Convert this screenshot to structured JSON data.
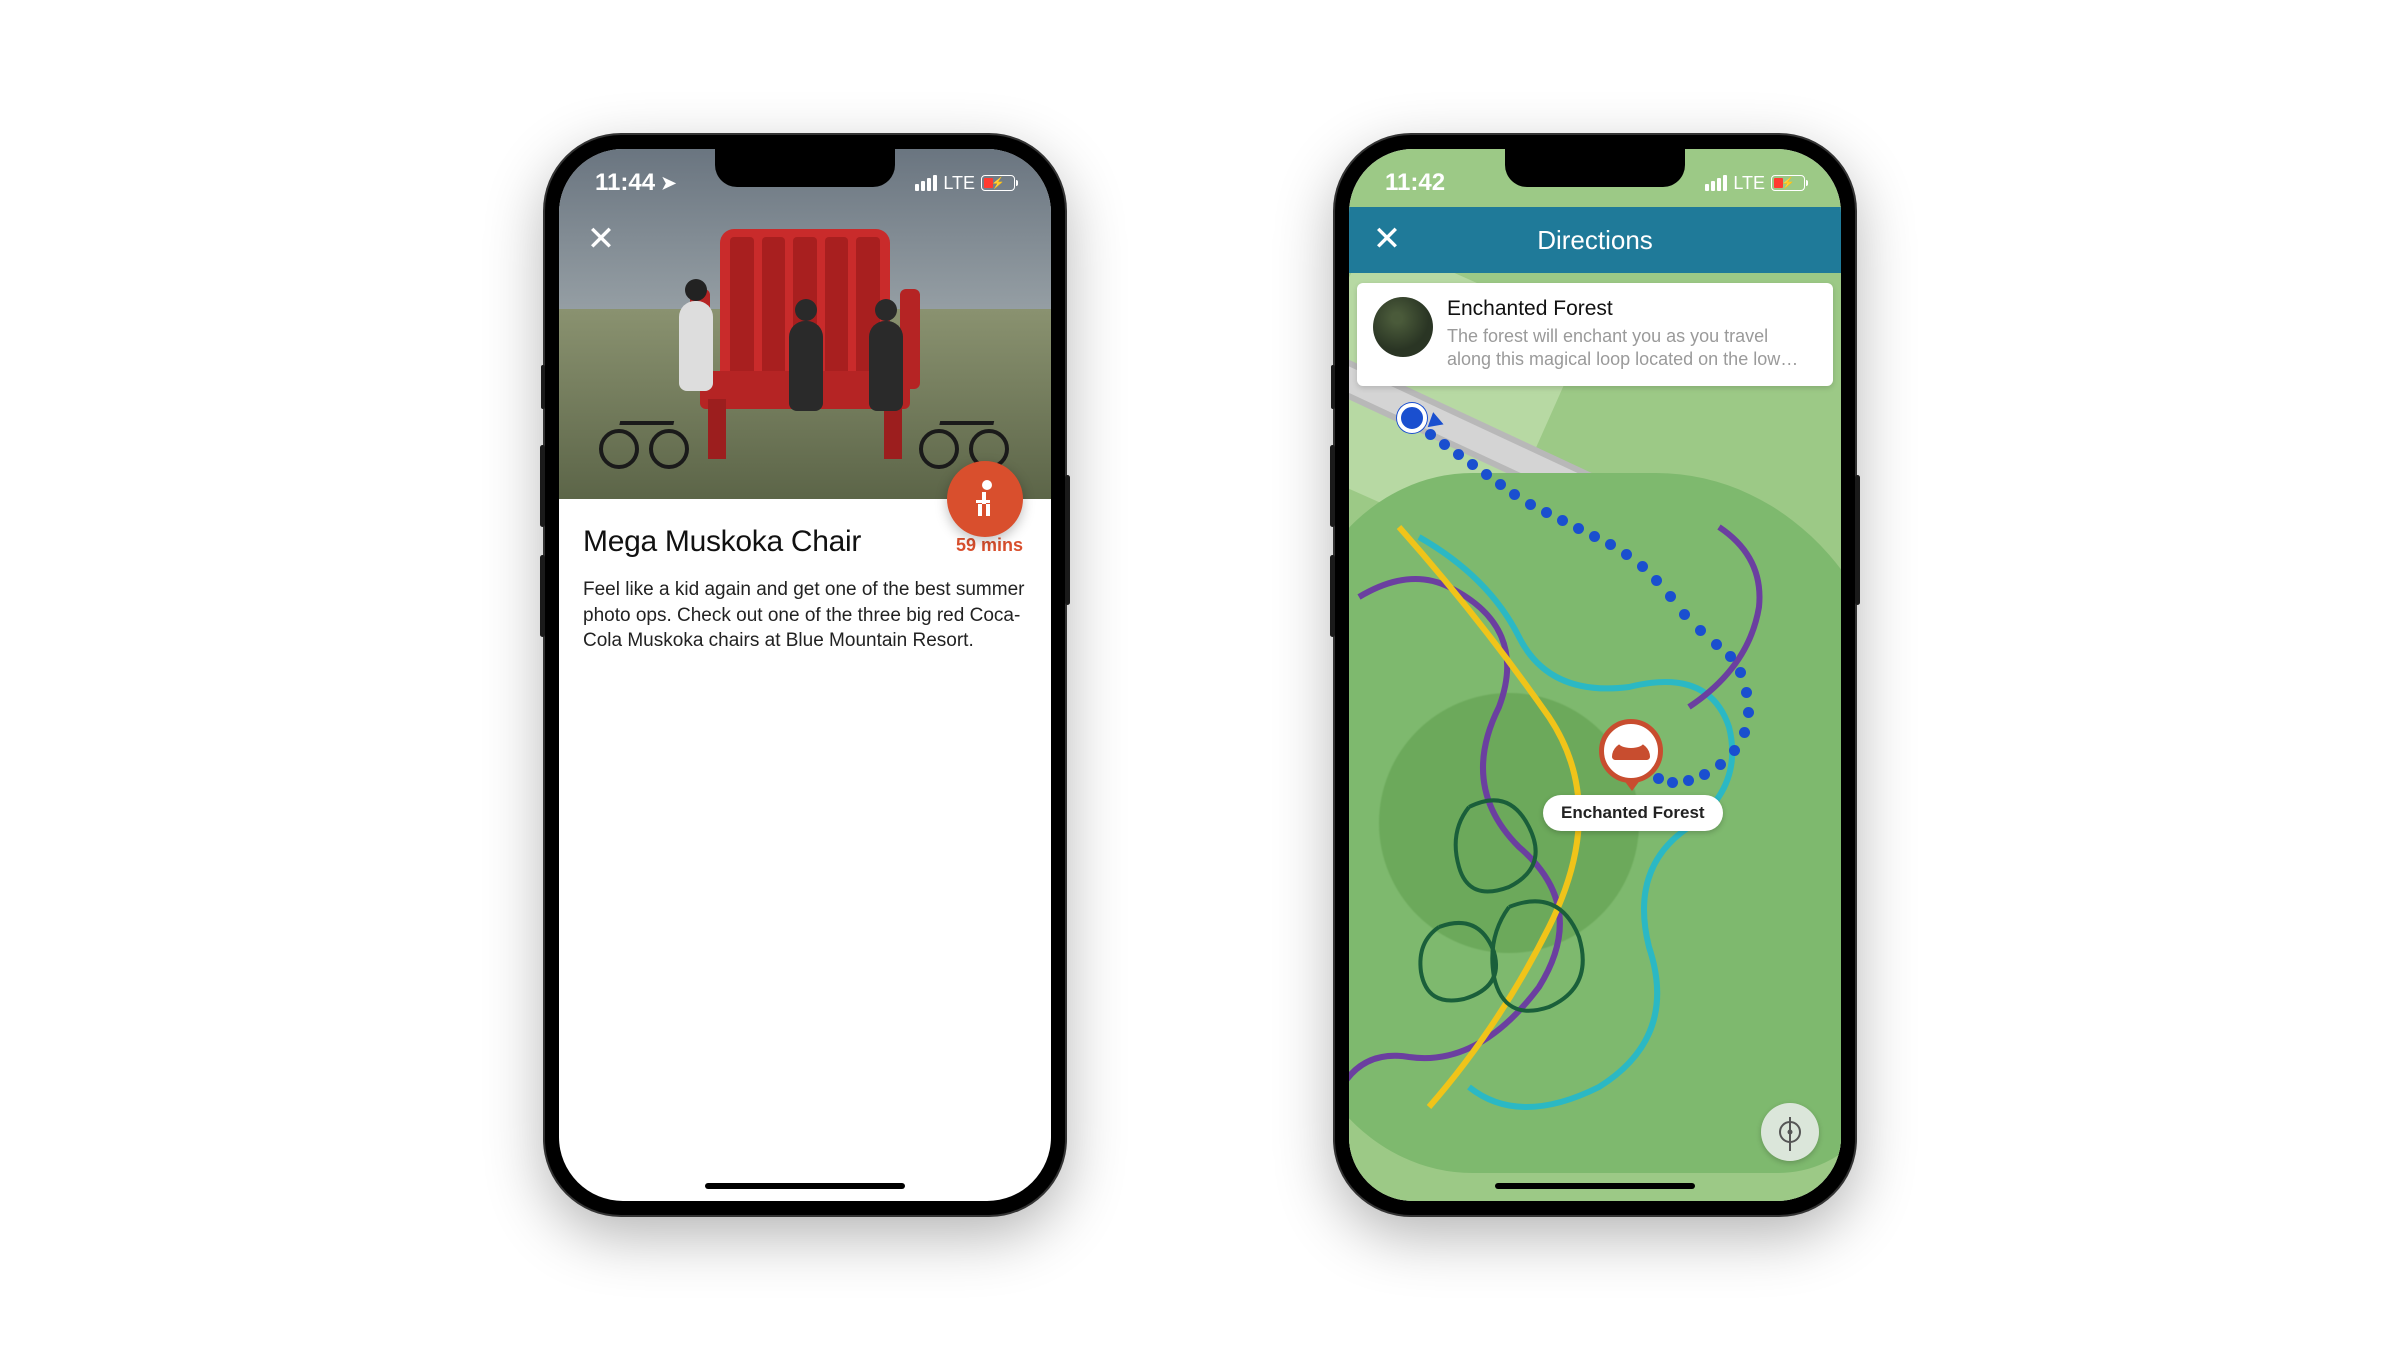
{
  "status": {
    "time_left": "11:44",
    "time_right": "11:42",
    "network": "LTE"
  },
  "screen1": {
    "title": "Mega Muskoka Chair",
    "duration": "59 mins",
    "description": "Feel like a kid again and get one of the best summer photo ops. Check out one of the three big red Coca-Cola Muskoka chairs at Blue Mountain Resort."
  },
  "screen2": {
    "header": "Directions",
    "destination": {
      "title": "Enchanted Forest",
      "description": "The forest will enchant you as you travel along this magical loop located on the low…"
    },
    "poi_label": "Enchanted Forest"
  }
}
